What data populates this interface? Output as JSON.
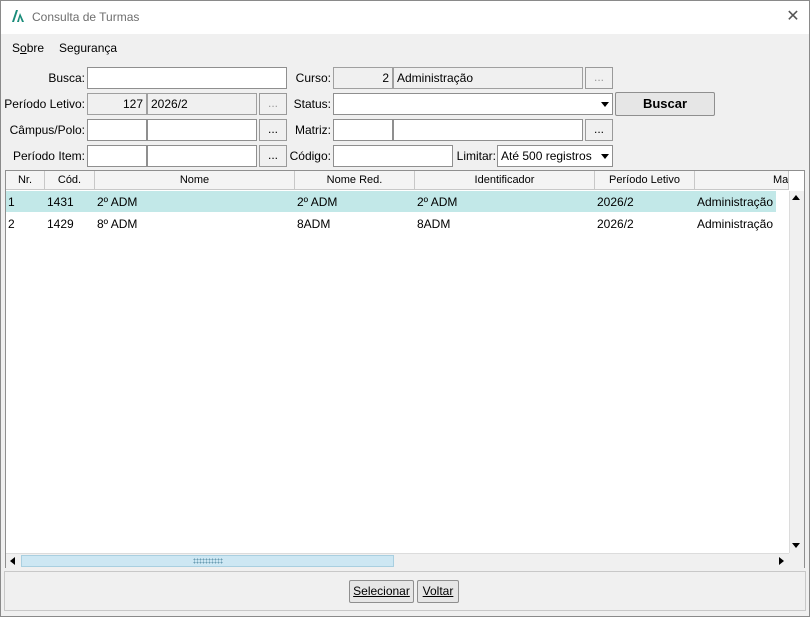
{
  "window": {
    "title": "Consulta de Turmas"
  },
  "menu": {
    "items": [
      {
        "label": "Sobre",
        "underline": "o"
      },
      {
        "label": "Segurança"
      }
    ]
  },
  "form": {
    "busca": {
      "label": "Busca:",
      "value": ""
    },
    "curso": {
      "label": "Curso:",
      "code": "2",
      "name": "Administração"
    },
    "periodo_letivo": {
      "label": "Período Letivo:",
      "code": "127",
      "name": "2026/2"
    },
    "status": {
      "label": "Status:",
      "value": ""
    },
    "campus": {
      "label": "Câmpus/Polo:",
      "code": "",
      "name": ""
    },
    "matriz": {
      "label": "Matriz:",
      "code": "",
      "name": ""
    },
    "periodo_item": {
      "label": "Período Item:",
      "code": "",
      "name": ""
    },
    "codigo": {
      "label": "Código:",
      "value": ""
    },
    "limitar": {
      "label": "Limitar:",
      "value": "Até 500 registros"
    },
    "buscar_label": "Buscar",
    "dots": "..."
  },
  "table": {
    "columns": [
      "Nr.",
      "Cód.",
      "Nome",
      "Nome Red.",
      "Identificador",
      "Período Letivo",
      "Matriz"
    ],
    "rows": [
      [
        "1",
        "1431",
        "2º ADM",
        "2º ADM",
        "2º ADM",
        "2026/2",
        "Administração"
      ],
      [
        "2",
        "1429",
        "8º ADM",
        "8ADM",
        "8ADM",
        "2026/2",
        "Administração"
      ]
    ],
    "selected_row": 0
  },
  "footer": {
    "selecionar": "Selecionar",
    "voltar": "Voltar"
  },
  "colors": {
    "selection": "#c2e8e8",
    "logo": "#1a8c7a"
  }
}
